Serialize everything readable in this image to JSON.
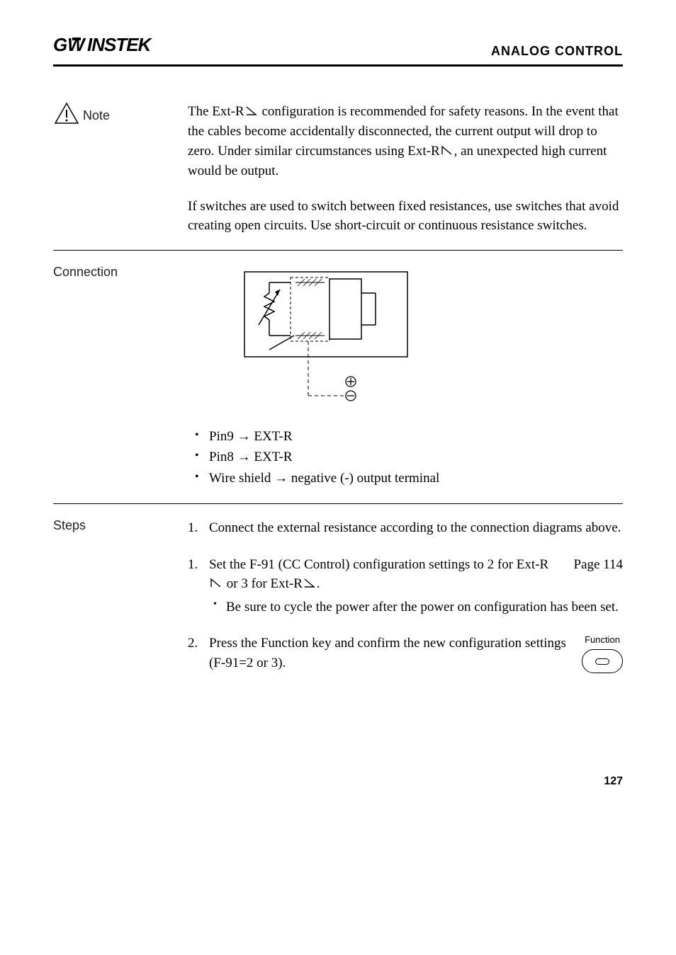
{
  "header": {
    "logo": "GWINSTEK",
    "title": "ANALOG CONTROL"
  },
  "note": {
    "label": "Note",
    "para1_a": "The Ext-R",
    "para1_b": " configuration is recommended for safety reasons. In the event that the cables become accidentally disconnected, the current output will drop to zero. Under similar circumstances using Ext-R",
    "para1_c": ", an unexpected high current would be output.",
    "para2": "If switches are used to switch between fixed resistances, use switches that avoid creating open circuits. Use short-circuit or continuous resistance switches."
  },
  "connection": {
    "label": "Connection",
    "bullets": [
      "Pin9 → EXT-R",
      "Pin8 → EXT-R",
      "Wire shield → negative (-) output terminal"
    ]
  },
  "steps": {
    "label": "Steps",
    "items": [
      {
        "num": "1.",
        "text": "Connect the external resistance according to the connection diagrams above."
      },
      {
        "num": "1.",
        "text_a": "Set the F-91 (CC Control) configuration settings to 2 for Ext-R",
        "text_b": " or 3 for Ext-R",
        "text_c": ".",
        "page_ref": "Page 114",
        "sub": "Be sure to cycle the power after the power on configuration has been set."
      },
      {
        "num": "2.",
        "text": "Press the Function key and confirm the new configuration settings (F-91=2 or 3).",
        "button_label": "Function"
      }
    ]
  },
  "page_number": "127"
}
